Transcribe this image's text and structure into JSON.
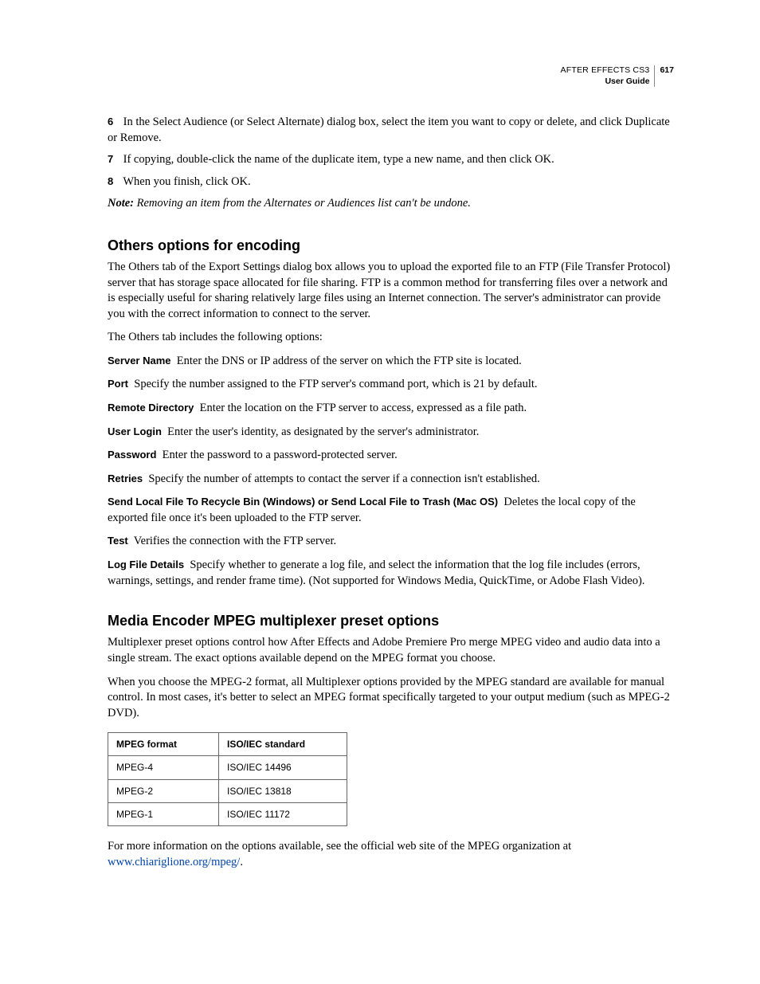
{
  "header": {
    "product": "AFTER EFFECTS CS3",
    "guide": "User Guide",
    "page_number": "617"
  },
  "steps": [
    {
      "num": "6",
      "text": "In the Select Audience (or Select Alternate) dialog box, select the item you want to copy or delete, and click Duplicate or Remove."
    },
    {
      "num": "7",
      "text": "If copying, double-click the name of the duplicate item, type a new name, and then click OK."
    },
    {
      "num": "8",
      "text": "When you finish, click OK."
    }
  ],
  "note": {
    "label": "Note:",
    "text": "Removing an item from the Alternates or Audiences list can't be undone."
  },
  "section1": {
    "heading": "Others options for encoding",
    "p1": "The Others tab of the Export Settings dialog box allows you to upload the exported file to an FTP (File Transfer Protocol) server that has storage space allocated for file sharing. FTP is a common method for transferring files over a network and is especially useful for sharing relatively large files using an Internet connection. The server's administrator can provide you with the correct information to connect to the server.",
    "p2": "The Others tab includes the following options:",
    "defs": [
      {
        "term": "Server Name",
        "desc": "Enter the DNS or IP address of the server on which the FTP site is located."
      },
      {
        "term": "Port",
        "desc": "Specify the number assigned to the FTP server's command port, which is 21 by default."
      },
      {
        "term": "Remote Directory",
        "desc": "Enter the location on the FTP server to access, expressed as a file path."
      },
      {
        "term": "User Login",
        "desc": "Enter the user's identity, as designated by the server's administrator."
      },
      {
        "term": "Password",
        "desc": "Enter the password to a password-protected server."
      },
      {
        "term": "Retries",
        "desc": "Specify the number of attempts to contact the server if a connection isn't established."
      },
      {
        "term": "Send Local File To Recycle Bin (Windows) or Send Local File to Trash (Mac OS)",
        "desc": "Deletes the local copy of the exported file once it's been uploaded to the FTP server."
      },
      {
        "term": "Test",
        "desc": "Verifies the connection with the FTP server."
      },
      {
        "term": "Log File Details",
        "desc": "Specify whether to generate a log file, and select the information that the log file includes (errors, warnings, settings, and render frame time). (Not supported for Windows Media, QuickTime, or Adobe Flash Video)."
      }
    ]
  },
  "section2": {
    "heading": "Media Encoder MPEG multiplexer preset options",
    "p1": "Multiplexer preset options control how After Effects and Adobe Premiere Pro merge MPEG video and audio data into a single stream. The exact options available depend on the MPEG format you choose.",
    "p2": "When you choose the MPEG-2 format, all Multiplexer options provided by the MPEG standard are available for manual control. In most cases, it's better to select an MPEG format specifically targeted to your output medium (such as MPEG-2 DVD).",
    "table": {
      "headers": [
        "MPEG format",
        "ISO/IEC standard"
      ],
      "rows": [
        [
          "MPEG-4",
          "ISO/IEC 14496"
        ],
        [
          "MPEG-2",
          "ISO/IEC 13818"
        ],
        [
          "MPEG-1",
          "ISO/IEC 11172"
        ]
      ]
    },
    "footer_pre": "For more information on the options available, see the official web site of the MPEG organization at ",
    "footer_link": "www.chiariglione.org/mpeg/",
    "footer_post": "."
  }
}
